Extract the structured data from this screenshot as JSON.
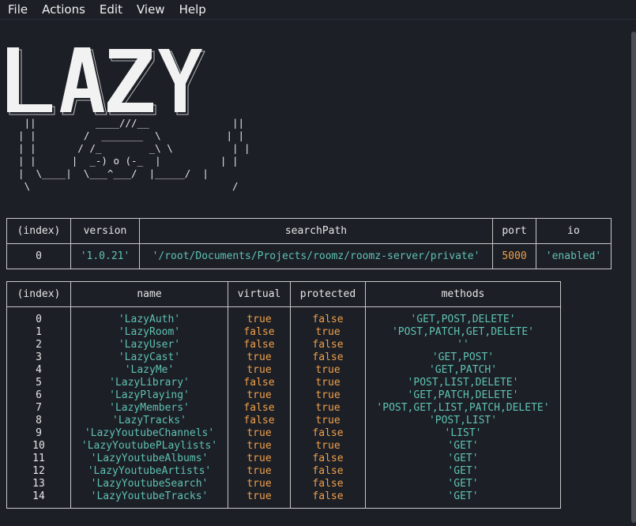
{
  "menu": [
    "File",
    "Actions",
    "Edit",
    "View",
    "Help"
  ],
  "banner": {
    "logo_text": "LAZY",
    "ascii_art": "   ||          ____///__              ||\n  | |        /  _______  \\           | |\n  | |       / /_        _\\ \\          | |\n  | |      |  _-) o (-_  |          | |\n  |  \\____|  \\___^___/  |_____/  |\n   \\                                  /"
  },
  "server_table": {
    "headers": [
      "(index)",
      "version",
      "searchPath",
      "port",
      "io"
    ],
    "row": {
      "index": "0",
      "version": "'1.0.21'",
      "searchPath": "'/root/Documents/Projects/roomz/roomz-server/private'",
      "port": "5000",
      "io": "'enabled'"
    }
  },
  "routes_table": {
    "headers": [
      "(index)",
      "name",
      "virtual",
      "protected",
      "methods"
    ],
    "rows": [
      {
        "index": "0",
        "name": "'LazyAuth'",
        "virtual": "true",
        "protected": "false",
        "methods": "'GET,POST,DELETE'"
      },
      {
        "index": "1",
        "name": "'LazyRoom'",
        "virtual": "false",
        "protected": "true",
        "methods": "'POST,PATCH,GET,DELETE'"
      },
      {
        "index": "2",
        "name": "'LazyUser'",
        "virtual": "false",
        "protected": "false",
        "methods": "''"
      },
      {
        "index": "3",
        "name": "'LazyCast'",
        "virtual": "true",
        "protected": "false",
        "methods": "'GET,POST'"
      },
      {
        "index": "4",
        "name": "'LazyMe'",
        "virtual": "true",
        "protected": "true",
        "methods": "'GET,PATCH'"
      },
      {
        "index": "5",
        "name": "'LazyLibrary'",
        "virtual": "false",
        "protected": "true",
        "methods": "'POST,LIST,DELETE'"
      },
      {
        "index": "6",
        "name": "'LazyPlaying'",
        "virtual": "true",
        "protected": "true",
        "methods": "'GET,PATCH,DELETE'"
      },
      {
        "index": "7",
        "name": "'LazyMembers'",
        "virtual": "false",
        "protected": "true",
        "methods": "'POST,GET,LIST,PATCH,DELETE'"
      },
      {
        "index": "8",
        "name": "'LazyTracks'",
        "virtual": "false",
        "protected": "true",
        "methods": "'POST,LIST'"
      },
      {
        "index": "9",
        "name": "'LazyYoutubeChannels'",
        "virtual": "true",
        "protected": "false",
        "methods": "'LIST'"
      },
      {
        "index": "10",
        "name": "'LazyYoutubePLaylists'",
        "virtual": "true",
        "protected": "true",
        "methods": "'GET'"
      },
      {
        "index": "11",
        "name": "'LazyYoutubeAlbums'",
        "virtual": "true",
        "protected": "false",
        "methods": "'GET'"
      },
      {
        "index": "12",
        "name": "'LazyYoutubeArtists'",
        "virtual": "true",
        "protected": "false",
        "methods": "'GET'"
      },
      {
        "index": "13",
        "name": "'LazyYoutubeSearch'",
        "virtual": "true",
        "protected": "false",
        "methods": "'GET'"
      },
      {
        "index": "14",
        "name": "'LazyYoutubeTracks'",
        "virtual": "true",
        "protected": "false",
        "methods": "'GET'"
      }
    ]
  },
  "colors": {
    "background": "#1c1f26",
    "string": "#5fc2b2",
    "number_boolean": "#f0a04b",
    "text": "#e6e6e6"
  }
}
